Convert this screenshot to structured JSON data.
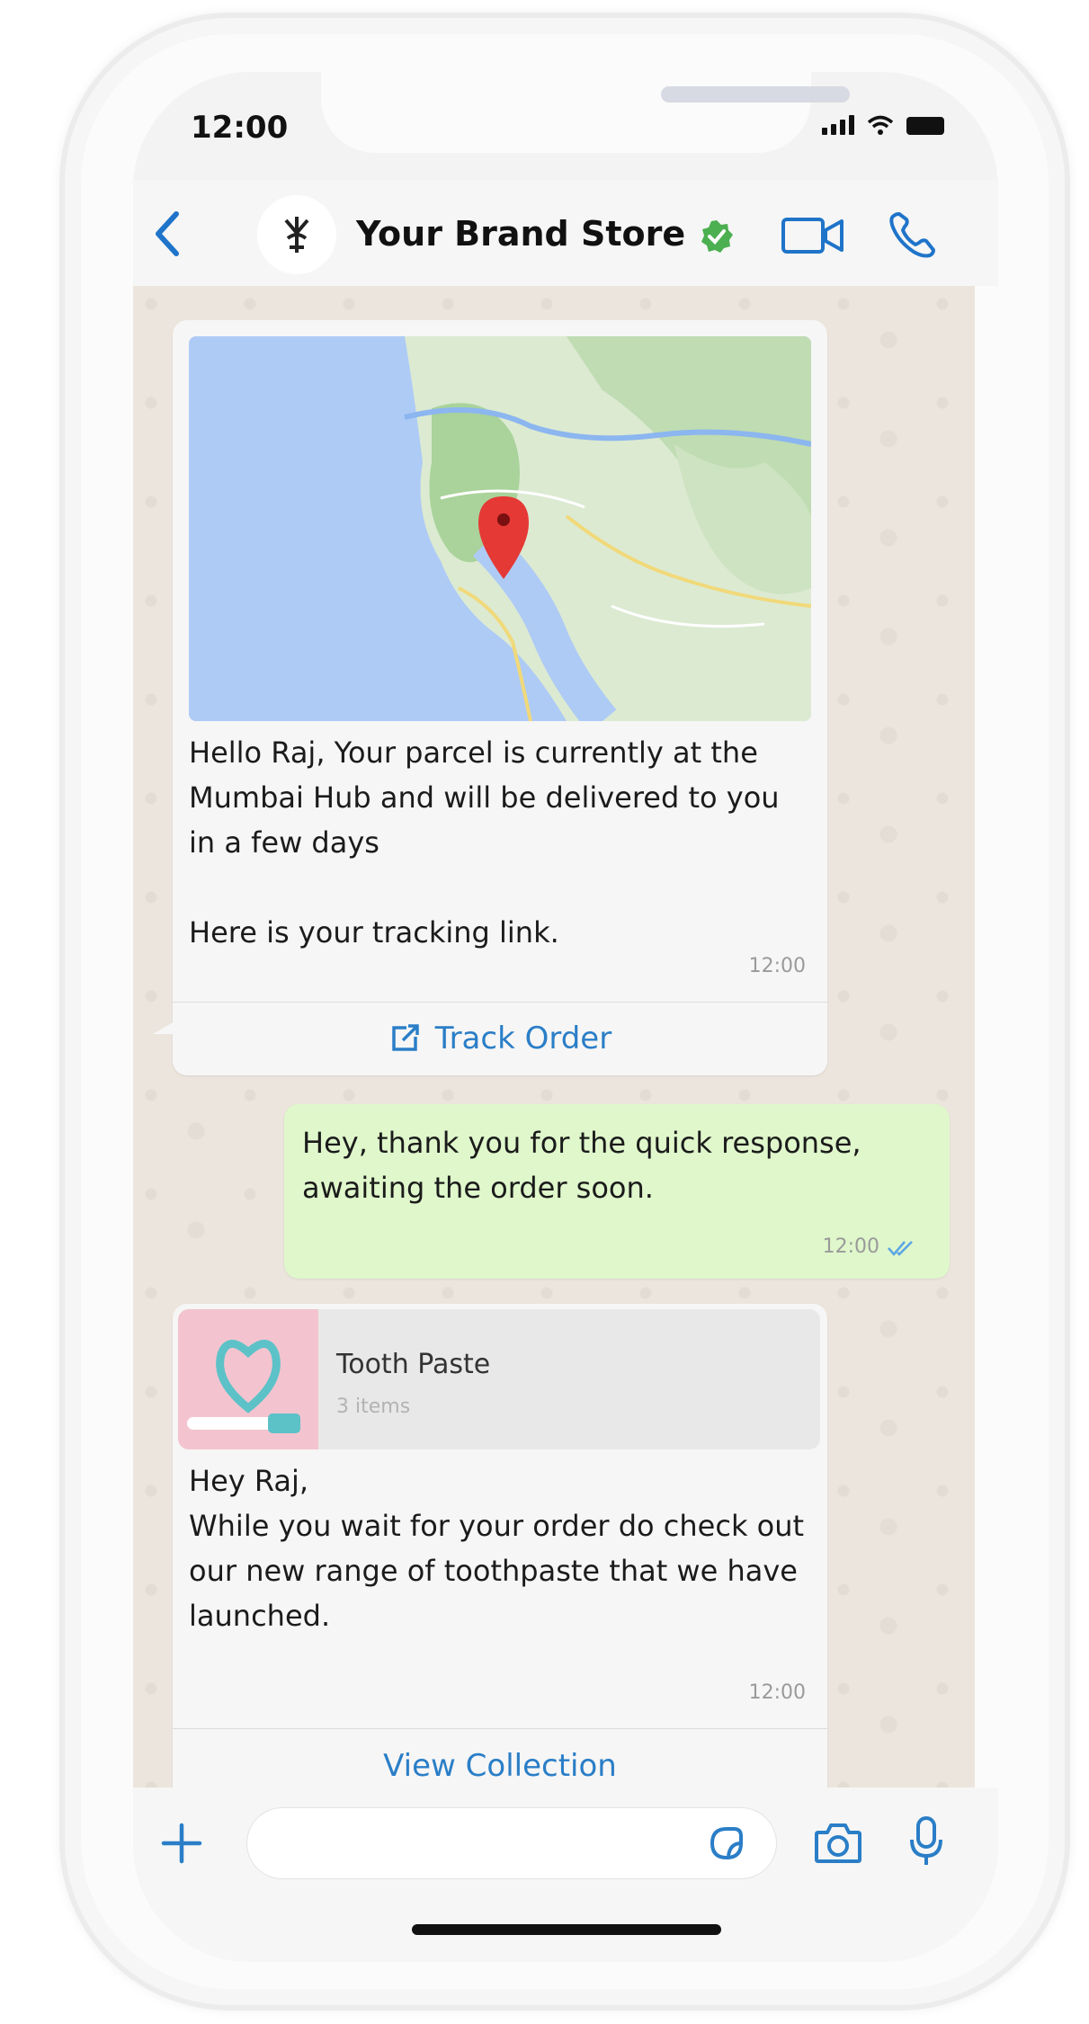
{
  "status_bar": {
    "time": "12:00"
  },
  "header": {
    "store_name": "Your Brand Store",
    "icons": [
      "back-icon",
      "brand-avatar",
      "verified-icon",
      "video-call-icon",
      "phone-call-icon"
    ]
  },
  "messages": [
    {
      "direction": "incoming",
      "type": "location_template",
      "text": "Hello Raj, Your parcel is currently at the Mumbai Hub and will be delivered to you in a few days\n\nHere is your tracking link.",
      "time": "12:00",
      "button": {
        "label": "Track Order",
        "icon": "external-link-icon"
      }
    },
    {
      "direction": "outgoing",
      "text": "Hey, thank you for the quick response, awaiting the order soon.",
      "time": "12:00",
      "status_icon": "double-check-icon"
    },
    {
      "direction": "incoming",
      "type": "product_collection",
      "product": {
        "title": "Tooth Paste",
        "subtitle": "3 items"
      },
      "text": "Hey Raj,\nWhile you wait for your order do check out our new range of toothpaste that we have launched.",
      "time": "12:00",
      "button": {
        "label": "View Collection"
      }
    }
  ],
  "input_bar": {
    "placeholder": "",
    "icons": [
      "plus-icon",
      "sticker-icon",
      "camera-icon",
      "mic-icon"
    ]
  },
  "colors": {
    "accent": "#2a7ec7",
    "outgoing_bubble": "#dff7cb",
    "incoming_bubble": "#f6f6f6",
    "verified": "#4caf50",
    "map_pin": "#e53935"
  }
}
